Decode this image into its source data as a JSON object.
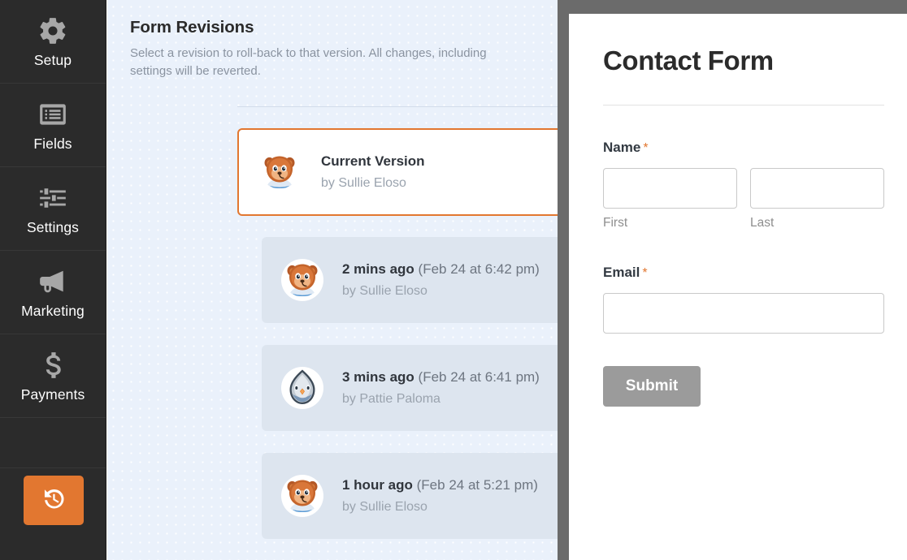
{
  "sidebar": {
    "items": [
      {
        "label": "Setup",
        "icon": "gear-icon",
        "name": "setup"
      },
      {
        "label": "Fields",
        "icon": "list-icon",
        "name": "fields"
      },
      {
        "label": "Settings",
        "icon": "sliders-icon",
        "name": "settings"
      },
      {
        "label": "Marketing",
        "icon": "megaphone-icon",
        "name": "marketing"
      },
      {
        "label": "Payments",
        "icon": "dollar-icon",
        "name": "payments"
      }
    ],
    "revisions_button": {
      "icon": "history-revert-icon",
      "color": "#e27730"
    }
  },
  "panel": {
    "title": "Form Revisions",
    "description": "Select a revision to roll-back to that version. All changes, including settings will be reverted.",
    "current": {
      "title": "Current Version",
      "author": "by Sullie Eloso",
      "avatar": "bear-avatar",
      "selected": true,
      "accent_color": "#e27730"
    },
    "revisions": [
      {
        "relative": "2 mins ago",
        "date": "(Feb 24 at 6:42 pm)",
        "author": "by Sullie Eloso",
        "avatar": "bear-avatar"
      },
      {
        "relative": "3 mins ago",
        "date": "(Feb 24 at 6:41 pm)",
        "author": "by Pattie Paloma",
        "avatar": "pigeon-avatar"
      },
      {
        "relative": "1 hour ago",
        "date": "(Feb 24 at 5:21 pm)",
        "author": "by Sullie Eloso",
        "avatar": "bear-avatar"
      }
    ]
  },
  "form_preview": {
    "title": "Contact Form",
    "fields": {
      "name": {
        "label": "Name",
        "required_marker": "*",
        "first": {
          "value": "",
          "sublabel": "First"
        },
        "last": {
          "value": "",
          "sublabel": "Last"
        }
      },
      "email": {
        "label": "Email",
        "required_marker": "*",
        "value": ""
      }
    },
    "submit_label": "Submit",
    "submit_color": "#9b9b9b"
  }
}
